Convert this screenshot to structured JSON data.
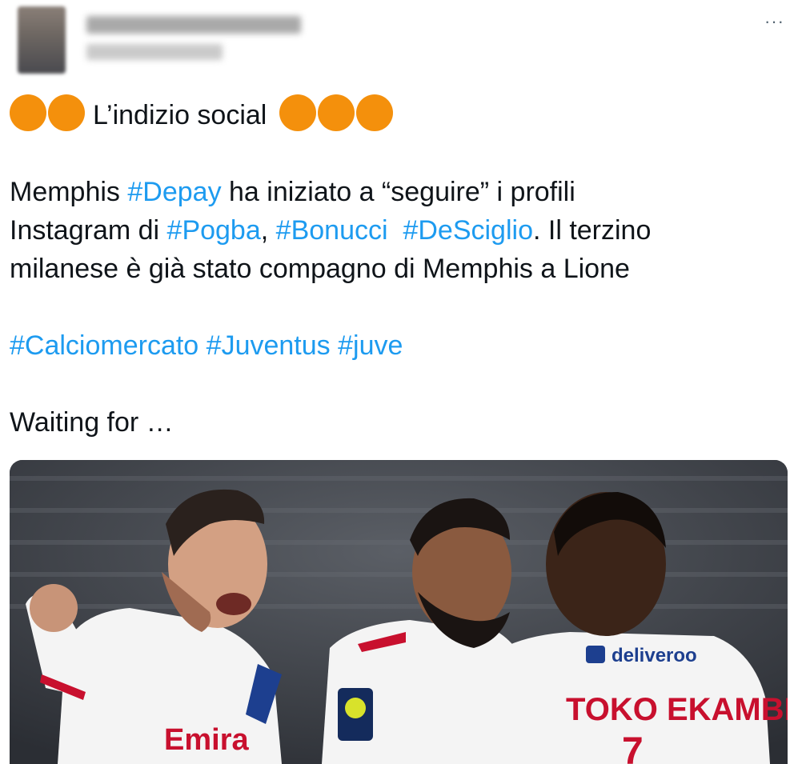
{
  "header": {
    "more_icon": "more-horizontal-icon",
    "more_label": "···"
  },
  "tweet": {
    "line1": {
      "emoji_name": "orange-circle",
      "emoji_color": "#f4900c",
      "text": "L’indizio social"
    },
    "line2": {
      "t1": "Memphis ",
      "h1": "#Depay",
      "t2": " ha iniziato a “seguire” i profili"
    },
    "line3": {
      "t1": "Instagram di ",
      "h1": "#Pogba",
      "t2": ", ",
      "h2": "#Bonucci",
      "t3": "  ",
      "h3": "#DeSciglio",
      "t4": ". Il terzino"
    },
    "line4": "milanese è già stato compagno di Memphis a Lione",
    "hashtags": [
      "#Calciomercato",
      "#Juventus",
      "#juve"
    ],
    "line6": "Waiting for  …",
    "hashtag_color": "#1d9bf0"
  },
  "photo": {
    "sponsor": "deliveroo",
    "shirt_name": "TOKO EKAMBI",
    "chest_text": "Emira",
    "badge_number": "7"
  }
}
